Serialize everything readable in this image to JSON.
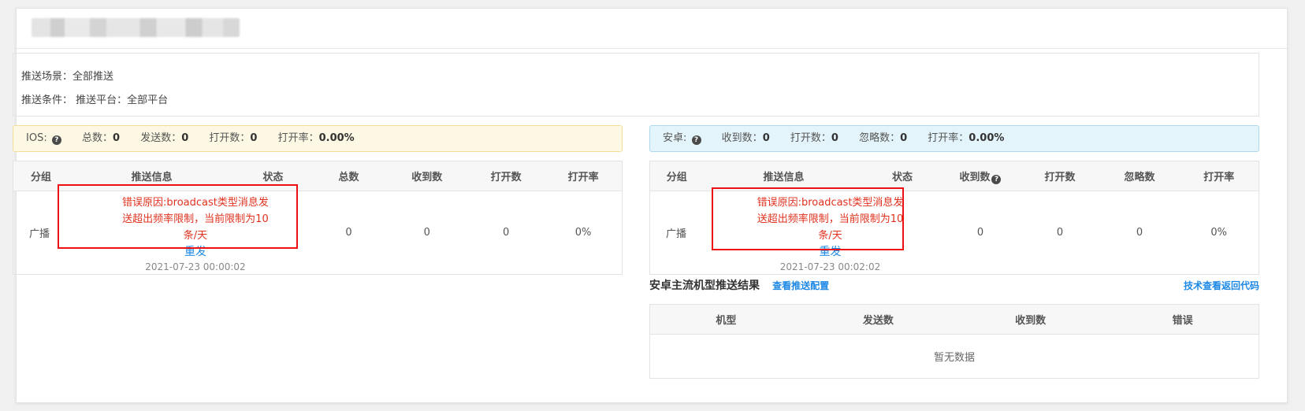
{
  "info": {
    "scene_label": "推送场景：",
    "scene_value": "全部推送",
    "cond_label": "推送条件：",
    "cond_value": "推送平台：全部平台"
  },
  "ios": {
    "platform_label": "IOS:",
    "stats": [
      {
        "label": "总数：",
        "value": "0"
      },
      {
        "label": "发送数：",
        "value": "0"
      },
      {
        "label": "打开数：",
        "value": "0"
      },
      {
        "label": "打开率：",
        "value": "0.00%"
      }
    ],
    "columns": [
      "分组",
      "推送信息",
      "状态",
      "总数",
      "收到数",
      "打开数",
      "打开率"
    ],
    "row": {
      "group": "广播",
      "error": "错误原因:broadcast类型消息发送超出频率限制，当前限制为10条/天",
      "resend": "重发",
      "time": "2021-07-23 00:00:02",
      "status": "",
      "c1": "0",
      "c2": "0",
      "c3": "0",
      "c4": "0%"
    }
  },
  "android": {
    "platform_label": "安卓:",
    "stats": [
      {
        "label": "收到数：",
        "value": "0"
      },
      {
        "label": "打开数：",
        "value": "0"
      },
      {
        "label": "忽略数：",
        "value": "0"
      },
      {
        "label": "打开率：",
        "value": "0.00%"
      }
    ],
    "columns": [
      "分组",
      "推送信息",
      "状态",
      "收到数",
      "打开数",
      "忽略数",
      "打开率"
    ],
    "row": {
      "group": "广播",
      "error": "错误原因:broadcast类型消息发送超出频率限制，当前限制为10条/天",
      "resend": "重发",
      "time": "2021-07-23 00:02:02",
      "status": "",
      "c1": "0",
      "c2": "0",
      "c3": "0",
      "c4": "0%"
    }
  },
  "models": {
    "title": "安卓主流机型推送结果",
    "config_link": "查看推送配置",
    "code_link": "技术查看返回代码",
    "columns": [
      "机型",
      "发送数",
      "收到数",
      "错误"
    ],
    "empty": "暂无数据"
  }
}
